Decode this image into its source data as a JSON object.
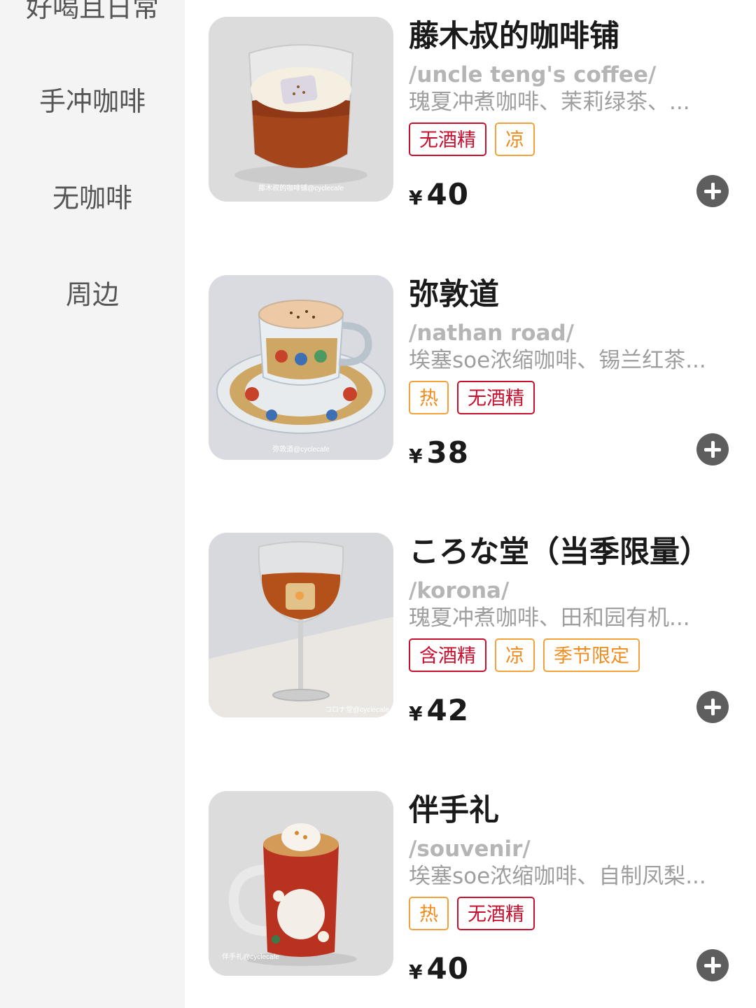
{
  "sidebar": {
    "categories": [
      "好喝且日常",
      "手冲咖啡",
      "无咖啡",
      "周边"
    ]
  },
  "currency_symbol": "¥",
  "colors": {
    "tag_red": "#c8102e",
    "tag_orange": "#f08c1e",
    "add_button": "#5e5e5e",
    "sidebar_bg": "#f4f4f4"
  },
  "menu": [
    {
      "name": "藤木叔的咖啡铺",
      "en_name": "/uncle teng's coffee/",
      "description": "瑰夏冲煮咖啡、茉莉绿茶、...",
      "tags": [
        {
          "label": "无酒精",
          "color": "red"
        },
        {
          "label": "凉",
          "color": "orange"
        }
      ],
      "price": "40",
      "photo_watermark": "藤木叔的咖啡铺@cyclecafe",
      "add_icon": "plus-circle-icon"
    },
    {
      "name": "弥敦道",
      "en_name": "/nathan road/",
      "description": "埃塞soe浓缩咖啡、锡兰红茶...",
      "tags": [
        {
          "label": "热",
          "color": "orange"
        },
        {
          "label": "无酒精",
          "color": "red"
        }
      ],
      "price": "38",
      "photo_watermark": "弥敦道@cyclecafe",
      "add_icon": "plus-circle-icon"
    },
    {
      "name": "ころな堂（当季限量）",
      "en_name": "/korona/",
      "description": "瑰夏冲煮咖啡、田和园有机...",
      "tags": [
        {
          "label": "含酒精",
          "color": "red"
        },
        {
          "label": "凉",
          "color": "orange"
        },
        {
          "label": "季节限定",
          "color": "orange"
        }
      ],
      "price": "42",
      "photo_watermark": "コロナ堂@cyclecafe",
      "add_icon": "plus-circle-icon"
    },
    {
      "name": "伴手礼",
      "en_name": "/souvenir/",
      "description": "埃塞soe浓缩咖啡、自制凤梨...",
      "tags": [
        {
          "label": "热",
          "color": "orange"
        },
        {
          "label": "无酒精",
          "color": "red"
        }
      ],
      "price": "40",
      "photo_watermark": "伴手礼@cyclecafe",
      "add_icon": "plus-circle-icon"
    }
  ]
}
